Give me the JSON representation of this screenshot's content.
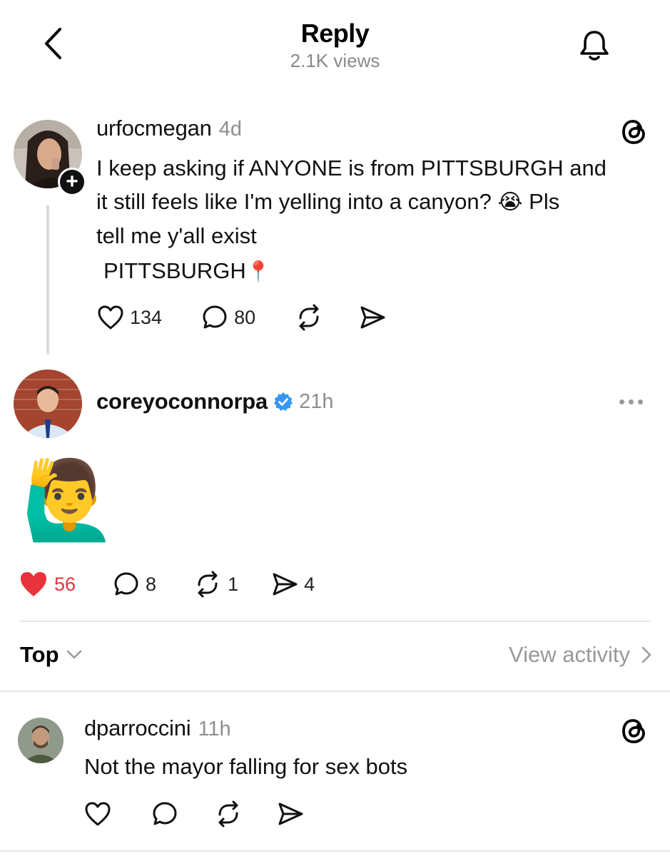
{
  "header": {
    "title": "Reply",
    "views": "2.1K views"
  },
  "post": {
    "username": "urfocmegan",
    "time": "4d",
    "text_line1": "I keep asking if ANYONE is from PITTSBURGH and",
    "text_line2a": "it still feels like I'm yelling into a canyon?",
    "text_emoji": "😭",
    "text_line2b": "Pls",
    "text_line3": "tell me y'all exist",
    "location": "PITTSBURGH",
    "location_emoji": "📍",
    "likes": "134",
    "replies": "80"
  },
  "reply": {
    "username": "coreyoconnorpa",
    "time": "21h",
    "emoji": "🙋‍♂️",
    "likes": "56",
    "replies": "8",
    "reposts": "1",
    "shares": "4",
    "like_color": "#e8323c"
  },
  "sort": {
    "label": "Top",
    "view_activity": "View activity"
  },
  "comment": {
    "username": "dparroccini",
    "time": "11h",
    "text": "Not the mayor falling for sex bots"
  }
}
